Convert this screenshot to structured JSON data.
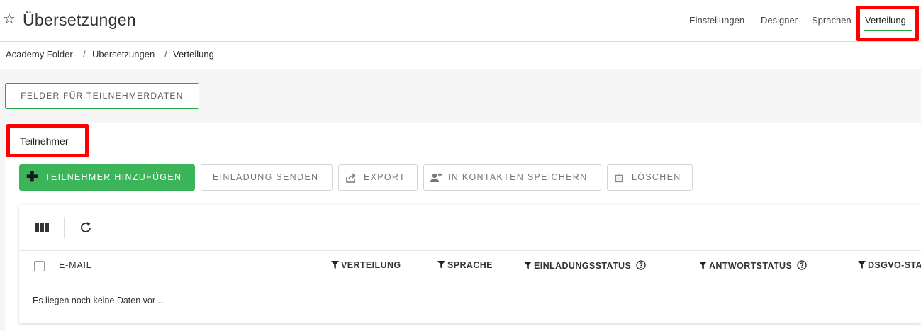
{
  "header": {
    "title": "Übersetzungen",
    "nav": {
      "einstellungen": "Einstellungen",
      "designer": "Designer",
      "sprachen": "Sprachen",
      "verteilung": "Verteilung"
    }
  },
  "breadcrumb": {
    "items": [
      "Academy Folder",
      "Übersetzungen",
      "Verteilung"
    ],
    "separator": "/"
  },
  "main": {
    "fields_button": "FELDER FÜR TEILNEHMERDATEN",
    "section_title": "Teilnehmer",
    "toolbar": {
      "add": "TEILNEHMER HINZUFÜGEN",
      "invite": "EINLADUNG SENDEN",
      "export": "EXPORT",
      "contacts": "IN KONTAKTEN SPEICHERN",
      "delete": "LÖSCHEN"
    },
    "table": {
      "columns": [
        "E-MAIL",
        "VERTEILUNG",
        "SPRACHE",
        "EINLADUNGSSTATUS",
        "ANTWORTSTATUS",
        "DSGVO-STA"
      ],
      "empty_message": "Es liegen noch keine Daten vor ..."
    }
  },
  "colors": {
    "accent_green": "#3cb55a",
    "highlight_red": "#ff0000",
    "outline_green": "#28a745"
  },
  "icons": [
    "star-icon",
    "plus-icon",
    "share-icon",
    "add-user-icon",
    "trash-icon",
    "columns-icon",
    "refresh-icon",
    "filter-icon",
    "help-icon"
  ]
}
